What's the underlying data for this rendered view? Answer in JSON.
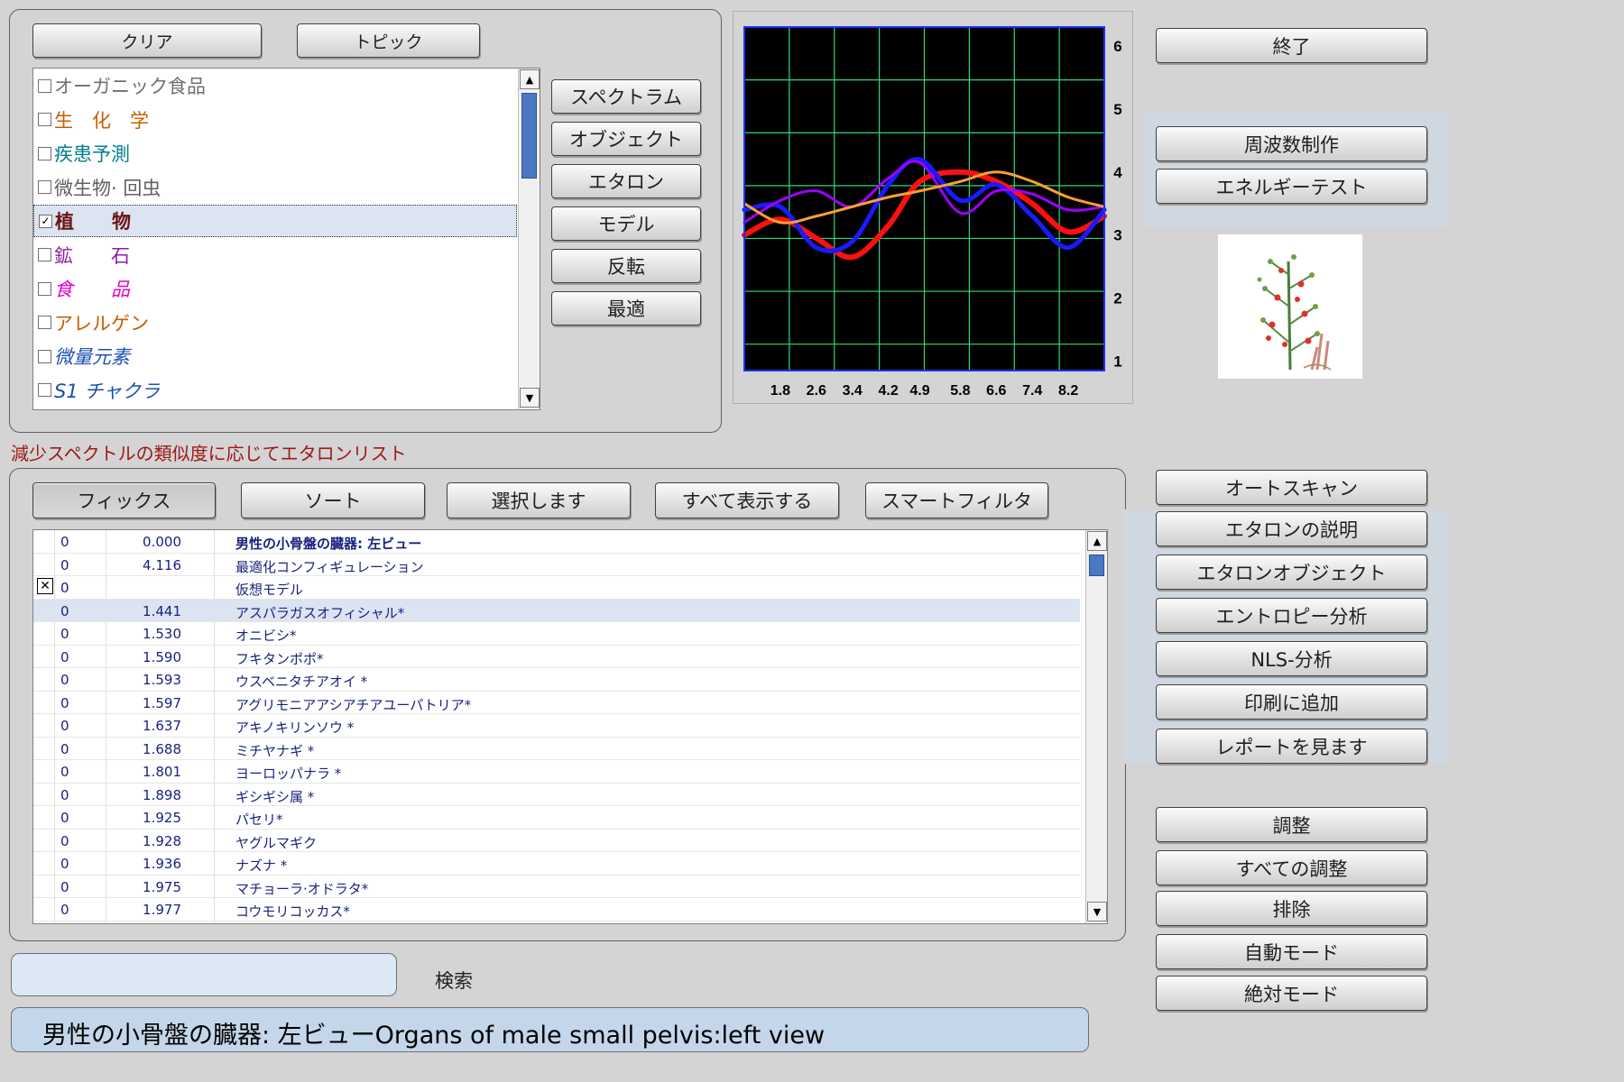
{
  "top_buttons": {
    "clear": "クリア",
    "topic": "トピック"
  },
  "categories": [
    {
      "label": "オーガニック食品",
      "checked": false,
      "color": "#707070",
      "italic": false,
      "selected": false
    },
    {
      "label": "生　化　学",
      "checked": false,
      "color": "#c65e00",
      "italic": false,
      "selected": false
    },
    {
      "label": "疾患予測",
      "checked": false,
      "color": "#00808a",
      "italic": false,
      "selected": false
    },
    {
      "label": "微生物· 回虫",
      "checked": false,
      "color": "#606060",
      "italic": false,
      "selected": false
    },
    {
      "label": "植　　物",
      "checked": true,
      "color": "#6a1414",
      "italic": false,
      "selected": true,
      "bold": true
    },
    {
      "label": "鉱　　石",
      "checked": false,
      "color": "#8b1fa0",
      "italic": false,
      "selected": false
    },
    {
      "label": "食　　品",
      "checked": false,
      "color": "#e600c8",
      "italic": true,
      "selected": false
    },
    {
      "label": "アレルゲン",
      "checked": false,
      "color": "#c65e00",
      "italic": false,
      "selected": false
    },
    {
      "label": "微量元素",
      "checked": false,
      "color": "#1a4fb0",
      "italic": true,
      "selected": false
    },
    {
      "label": "S1 チャクラ",
      "checked": false,
      "color": "#1a4fb0",
      "italic": true,
      "selected": false
    }
  ],
  "mode_buttons": [
    "スペクトラム",
    "オブジェクト",
    "エタロン",
    "モデル",
    "反転",
    "最適"
  ],
  "chart_data": {
    "type": "line",
    "x_ticks": [
      "1.8",
      "2.6",
      "3.4",
      "4.2",
      "4.9",
      "5.8",
      "6.6",
      "7.4",
      "8.2"
    ],
    "y_ticks": [
      "6",
      "5",
      "4",
      "3",
      "2",
      "1"
    ],
    "ylim": [
      0.85,
      6.3
    ],
    "xlim": [
      1.0,
      9.0
    ],
    "grid": true,
    "background": "#000000",
    "grid_color": "#2bdc7a",
    "series": [
      {
        "color": "#ff1010",
        "width": 6,
        "x": [
          1.0,
          1.8,
          2.6,
          3.4,
          4.2,
          4.9,
          5.8,
          6.6,
          7.4,
          8.2,
          9.0
        ],
        "y": [
          3.0,
          3.25,
          2.95,
          2.65,
          3.15,
          3.85,
          4.0,
          3.85,
          3.5,
          3.05,
          3.3
        ]
      },
      {
        "color": "#1a1aff",
        "width": 5,
        "x": [
          1.0,
          1.8,
          2.6,
          3.4,
          4.2,
          4.9,
          5.8,
          6.6,
          7.4,
          8.2,
          9.0
        ],
        "y": [
          3.4,
          3.45,
          2.8,
          2.9,
          3.8,
          4.2,
          3.55,
          3.8,
          3.3,
          2.8,
          3.4
        ]
      },
      {
        "color": "#a000ff",
        "width": 3,
        "x": [
          1.0,
          1.8,
          2.6,
          3.4,
          4.2,
          4.9,
          5.8,
          6.6,
          7.4,
          8.2,
          9.0
        ],
        "y": [
          3.2,
          3.55,
          3.7,
          3.45,
          3.9,
          4.15,
          3.35,
          3.7,
          3.65,
          3.4,
          3.45
        ]
      },
      {
        "color": "#ffa030",
        "width": 3,
        "x": [
          1.0,
          1.8,
          2.6,
          3.4,
          4.2,
          4.9,
          5.8,
          6.6,
          7.4,
          8.2,
          9.0
        ],
        "y": [
          3.5,
          3.2,
          3.3,
          3.45,
          3.6,
          3.7,
          3.85,
          4.0,
          3.85,
          3.6,
          3.45
        ]
      }
    ]
  },
  "right_buttons_top": [
    "終了",
    "周波数制作",
    "エネルギーテスト"
  ],
  "list_caption": "減少スペクトルの類似度に応じてエタロンリスト",
  "toolbar": [
    "フィックス",
    "ソート",
    "選択します",
    "すべて表示する",
    "スマートフィルタ"
  ],
  "rows": [
    {
      "check": "",
      "c0": "0",
      "c1": "0.000",
      "name": "男性の小骨盤の臓器: 左ビュー",
      "bold": true,
      "selected": false
    },
    {
      "check": "",
      "c0": "0",
      "c1": "4.116",
      "name": "最適化コンフィギュレーション",
      "bold": false,
      "selected": false
    },
    {
      "check": "✕",
      "c0": "0",
      "c1": "",
      "name": "仮想モデル",
      "bold": false,
      "selected": false
    },
    {
      "check": "",
      "c0": "0",
      "c1": "1.441",
      "name": "アスパラガスオフィシャル*",
      "bold": false,
      "selected": true
    },
    {
      "check": "",
      "c0": "0",
      "c1": "1.530",
      "name": "オニビシ*",
      "bold": false,
      "selected": false
    },
    {
      "check": "",
      "c0": "0",
      "c1": "1.590",
      "name": "フキタンポポ*",
      "bold": false,
      "selected": false
    },
    {
      "check": "",
      "c0": "0",
      "c1": "1.593",
      "name": "ウスベニタチアオイ *",
      "bold": false,
      "selected": false
    },
    {
      "check": "",
      "c0": "0",
      "c1": "1.597",
      "name": "アグリモニアアシアチアユーパトリア*",
      "bold": false,
      "selected": false
    },
    {
      "check": "",
      "c0": "0",
      "c1": "1.637",
      "name": "アキノキリンソウ *",
      "bold": false,
      "selected": false
    },
    {
      "check": "",
      "c0": "0",
      "c1": "1.688",
      "name": "ミチヤナギ *",
      "bold": false,
      "selected": false
    },
    {
      "check": "",
      "c0": "0",
      "c1": "1.801",
      "name": "ヨーロッパナラ *",
      "bold": false,
      "selected": false
    },
    {
      "check": "",
      "c0": "0",
      "c1": "1.898",
      "name": "ギシギシ属 *",
      "bold": false,
      "selected": false
    },
    {
      "check": "",
      "c0": "0",
      "c1": "1.925",
      "name": "パセリ*",
      "bold": false,
      "selected": false
    },
    {
      "check": "",
      "c0": "0",
      "c1": "1.928",
      "name": "ヤグルマギク",
      "bold": false,
      "selected": false
    },
    {
      "check": "",
      "c0": "0",
      "c1": "1.936",
      "name": "ナズナ *",
      "bold": false,
      "selected": false
    },
    {
      "check": "",
      "c0": "0",
      "c1": "1.975",
      "name": "マチョーラ·オドラタ*",
      "bold": false,
      "selected": false
    },
    {
      "check": "",
      "c0": "0",
      "c1": "1.977",
      "name": "コウモリコッカス*",
      "bold": false,
      "selected": false
    }
  ],
  "right_buttons_bottom": [
    "オートスキャン",
    "エタロンの説明",
    "エタロンオブジェクト",
    "エントロピー分析",
    "NLS-分析",
    "印刷に追加",
    "レポートを見ます"
  ],
  "right_buttons_adjust": [
    "調整",
    "すべての調整",
    "排除",
    "自動モード",
    "絶対モード"
  ],
  "search": {
    "value": "",
    "label": "検索"
  },
  "status_text": "男性の小骨盤の臓器: 左ビューOrgans of male small pelvis:left view"
}
